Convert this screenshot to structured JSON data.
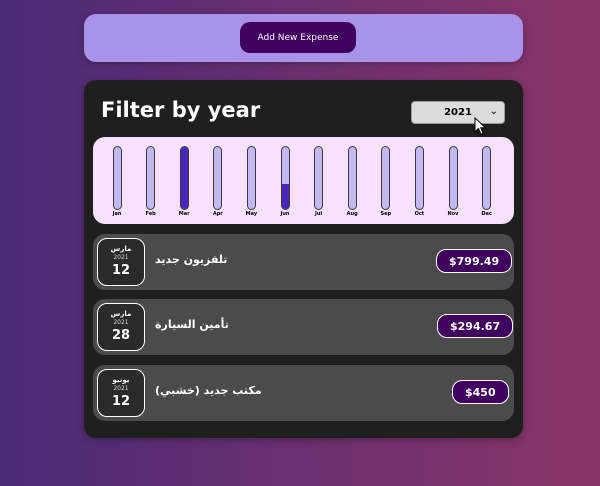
{
  "new_expense": {
    "add_button_label": "Add New Expense"
  },
  "filter": {
    "title": "Filter by year",
    "selected_year": "2021"
  },
  "chart_data": {
    "type": "bar",
    "categories": [
      "Jan",
      "Feb",
      "Mar",
      "Apr",
      "May",
      "Jun",
      "Jul",
      "Aug",
      "Sep",
      "Oct",
      "Nov",
      "Dec"
    ],
    "values": [
      0,
      0,
      1094.16,
      0,
      0,
      450,
      0,
      0,
      0,
      0,
      0,
      0
    ],
    "ylim": [
      0,
      1094.16
    ]
  },
  "expenses": [
    {
      "month": "مارس",
      "year": "2021",
      "day": "12",
      "title": "تلفزيون جديد",
      "amount": "$799.49"
    },
    {
      "month": "مارس",
      "year": "2021",
      "day": "28",
      "title": "تأمين السيارة",
      "amount": "$294.67"
    },
    {
      "month": "يونيو",
      "year": "2021",
      "day": "12",
      "title": "مكتب جديد (خشبي)",
      "amount": "$450"
    }
  ],
  "colors": {
    "accent": "#40005d",
    "bar_fill": "#4826b9",
    "bar_track": "#c3b9f0",
    "chart_bg": "#f8e1ff"
  }
}
